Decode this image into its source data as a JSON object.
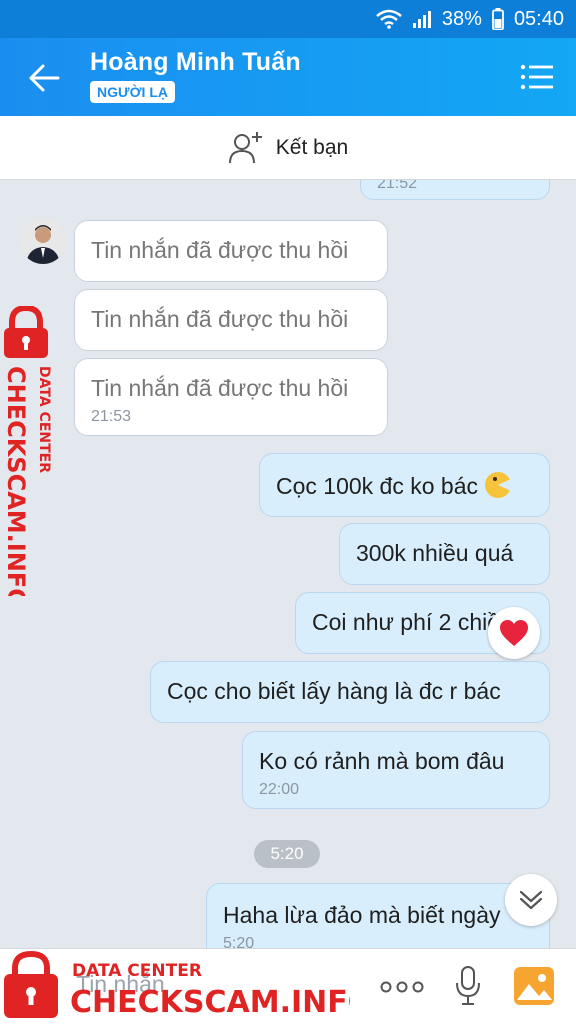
{
  "status_bar": {
    "battery": "38%",
    "time": "05:40"
  },
  "header": {
    "contact_name": "Hoàng Minh Tuấn",
    "badge": "NGƯỜI LẠ"
  },
  "add_friend": {
    "label": "Kết bạn"
  },
  "messages": [
    {
      "direction": "out",
      "text": "",
      "time": "21:52"
    },
    {
      "direction": "in",
      "text": "Tin nhắn đã được thu hồi"
    },
    {
      "direction": "in",
      "text": "Tin nhắn đã được thu hồi"
    },
    {
      "direction": "in",
      "text": "Tin nhắn đã được thu hồi",
      "time": "21:53"
    },
    {
      "direction": "out",
      "text": "Cọc 100k đc ko bác"
    },
    {
      "direction": "out",
      "text": "300k nhiều quá"
    },
    {
      "direction": "out",
      "text": "Coi như phí 2 chiều"
    },
    {
      "direction": "out",
      "text": "Cọc cho biết lấy hàng là đc r bác"
    },
    {
      "direction": "out",
      "text": "Ko có rảnh mà bom đâu",
      "time": "22:00"
    },
    {
      "direction": "out",
      "text": "Haha lừa đảo mà biết ngày",
      "time": "5:20"
    }
  ],
  "date_divider": "5:20",
  "reaction_icon": "heart-icon",
  "input": {
    "placeholder": "Tin nhắn"
  },
  "watermark": {
    "line1": "DATA CENTER",
    "line2": "CHECKSCAM.INFO"
  },
  "colors": {
    "header": "#1a8ef0",
    "outgoing_bubble": "#d9eefc",
    "incoming_bubble": "#ffffff",
    "watermark": "#e02323"
  }
}
